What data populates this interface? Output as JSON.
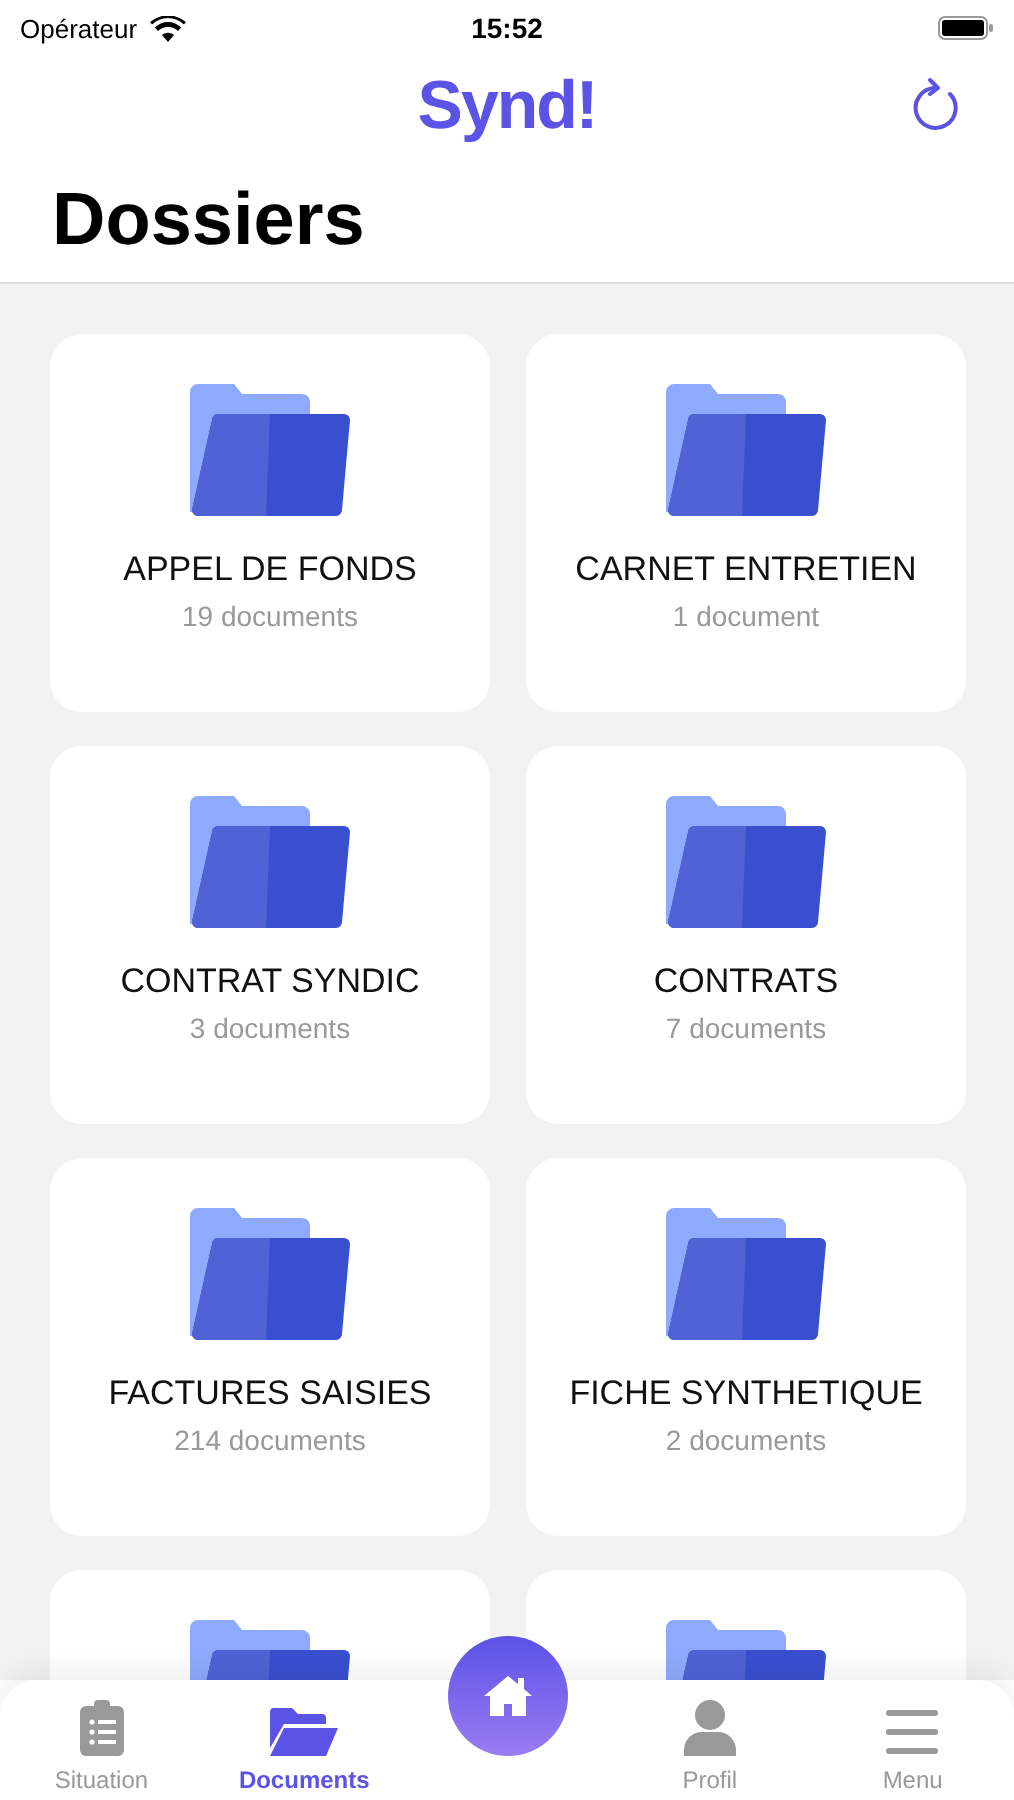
{
  "status_bar": {
    "carrier": "Opérateur",
    "time": "15:52"
  },
  "header": {
    "logo": "Synd!"
  },
  "title": "Dossiers",
  "folders": [
    {
      "kind": "full",
      "name": "APPEL DE FONDS",
      "count": "19 documents"
    },
    {
      "kind": "full",
      "name": "CARNET ENTRETIEN",
      "count": "1 document"
    },
    {
      "kind": "full",
      "name": "CONTRAT SYNDIC",
      "count": "3 documents"
    },
    {
      "kind": "full",
      "name": "CONTRATS",
      "count": "7 documents"
    },
    {
      "kind": "full",
      "name": "FACTURES SAISIES",
      "count": "214 documents"
    },
    {
      "kind": "full",
      "name": "FICHE SYNTHETIQUE",
      "count": "2 documents"
    },
    {
      "kind": "partial"
    },
    {
      "kind": "partial"
    }
  ],
  "tab_bar": {
    "tabs": [
      {
        "kind": "clipboard",
        "label": "Situation",
        "selected": false
      },
      {
        "kind": "folder",
        "label": "Documents",
        "selected": true
      },
      {
        "kind": "home"
      },
      {
        "kind": "person",
        "label": "Profil",
        "selected": false
      },
      {
        "kind": "menu",
        "label": "Menu",
        "selected": false
      }
    ]
  }
}
